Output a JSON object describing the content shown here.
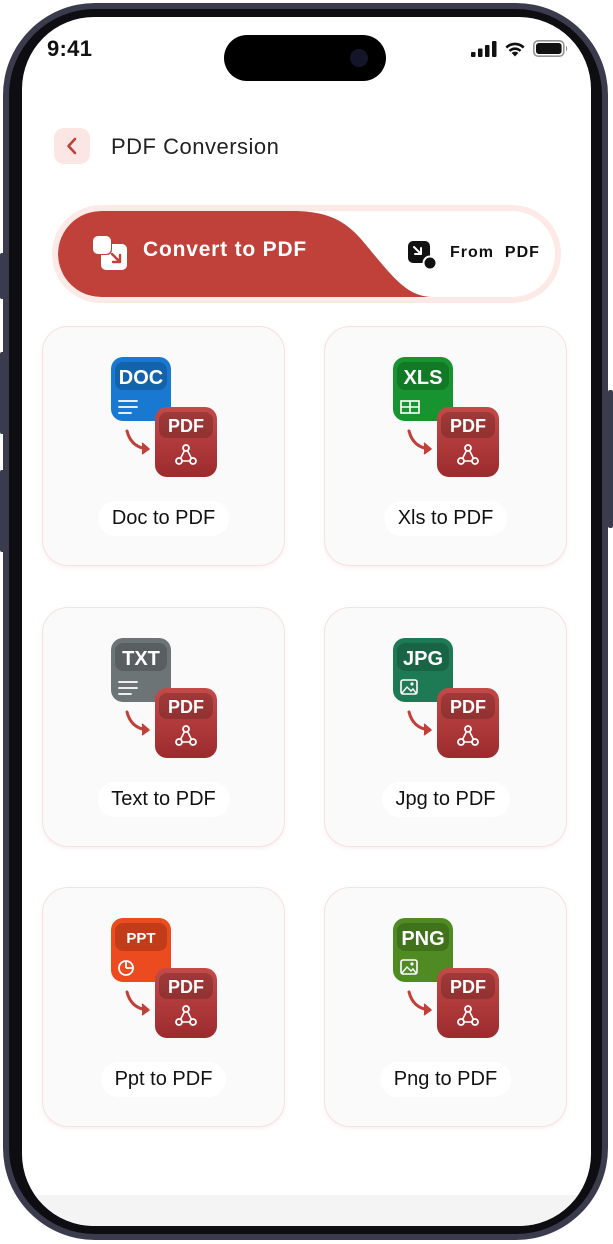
{
  "status_bar": {
    "time": "9:41"
  },
  "header": {
    "title": "PDF Conversion"
  },
  "toggle": {
    "active_label": "Convert to PDF",
    "inactive_label": "From  PDF"
  },
  "colors": {
    "accent": "#c0403a",
    "accent_light": "#fde9e6",
    "pdf_badge": "#b23434"
  },
  "cards": [
    {
      "label": "Doc to PDF",
      "badge": "DOC",
      "badge_color": "#1878d2",
      "glyph": "lines"
    },
    {
      "label": "Xls to PDF",
      "badge": "XLS",
      "badge_color": "#17942f",
      "glyph": "grid"
    },
    {
      "label": "Text to PDF",
      "badge": "TXT",
      "badge_color": "#6d7476",
      "glyph": "lines"
    },
    {
      "label": "Jpg to PDF",
      "badge": "JPG",
      "badge_color": "#1e7a55",
      "glyph": "image"
    },
    {
      "label": "Ppt to PDF",
      "badge": "PPT",
      "badge_color": "#ec4a1f",
      "glyph": "pie"
    },
    {
      "label": "Png to PDF",
      "badge": "PNG",
      "badge_color": "#4f8a22",
      "glyph": "image"
    }
  ],
  "pdf_badge_text": "PDF"
}
